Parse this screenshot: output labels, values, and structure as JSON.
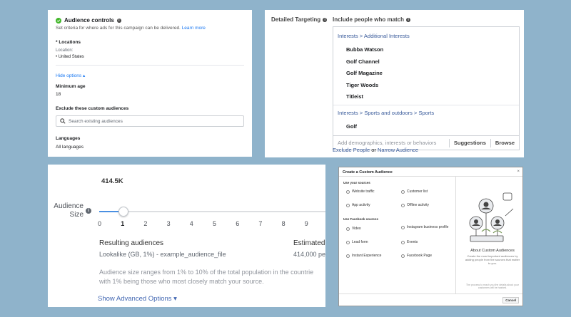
{
  "audience_controls": {
    "title": "Audience controls",
    "subtitle": "Set criteria for where ads for this campaign can be delivered.",
    "learn_more": "Learn more",
    "locations_label": "* Locations",
    "location_sub": "Location:",
    "location_value": "• United States",
    "hide_options": "Hide options ▴",
    "min_age_label": "Minimum age",
    "min_age_value": "18",
    "exclude_label": "Exclude these custom audiences",
    "search_placeholder": "Search existing audiences",
    "languages_label": "Languages",
    "languages_value": "All languages"
  },
  "detailed_targeting": {
    "label": "Detailed Targeting",
    "include_label": "Include people who match",
    "crumb1": [
      "Interests",
      ">",
      "Additional Interests"
    ],
    "group1": [
      "Bubba Watson",
      "Golf Channel",
      "Golf Magazine",
      "Tiger Woods",
      "Titleist"
    ],
    "crumb2": [
      "Interests",
      ">",
      "Sports and outdoors",
      ">",
      "Sports"
    ],
    "group2": [
      "Golf"
    ],
    "add_placeholder": "Add demographics, interests or behaviors",
    "suggestions": "Suggestions",
    "browse": "Browse",
    "exclude_people": "Exclude People",
    "or": " or ",
    "narrow_audience": "Narrow Audience"
  },
  "audience_size": {
    "label_line1": "Audience",
    "label_line2": "Size",
    "tooltip_value": "414.5K",
    "slider_value": 1,
    "ticks": [
      "0",
      "1",
      "2",
      "3",
      "4",
      "5",
      "6",
      "7",
      "8",
      "9"
    ],
    "resulting_header": "Resulting audiences",
    "resulting_value": "Lookalike (GB, 1%) - example_audience_file",
    "estimated_header": "Estimated",
    "estimated_value": "414,000 pe",
    "desc_line1": "Audience size ranges from 1% to 10% of the total population in the countrie",
    "desc_line2": "with 1% being those who most closely match your source.",
    "advanced": "Show Advanced Options ▾"
  },
  "custom_audience": {
    "title": "Create a Custom Audience",
    "close": "×",
    "section_your_sources": "Use your sources",
    "website_traffic": "Website traffic",
    "customer_list": "Customer list",
    "app_activity": "App activity",
    "offline_activity": "Offline activity",
    "section_facebook": "Use Facebook sources",
    "video": "Video",
    "instagram": "Instagram business profile",
    "lead_form": "Lead form",
    "events": "Events",
    "instant_experience": "Instant Experience",
    "facebook_page": "Facebook Page",
    "about_title": "About Custom Audiences",
    "about_desc": "Create the most important audiences by adding people from the sources that matter to you.",
    "note": "The process to reach you the details about your customers will be hashed.",
    "cancel": "Cancel"
  }
}
